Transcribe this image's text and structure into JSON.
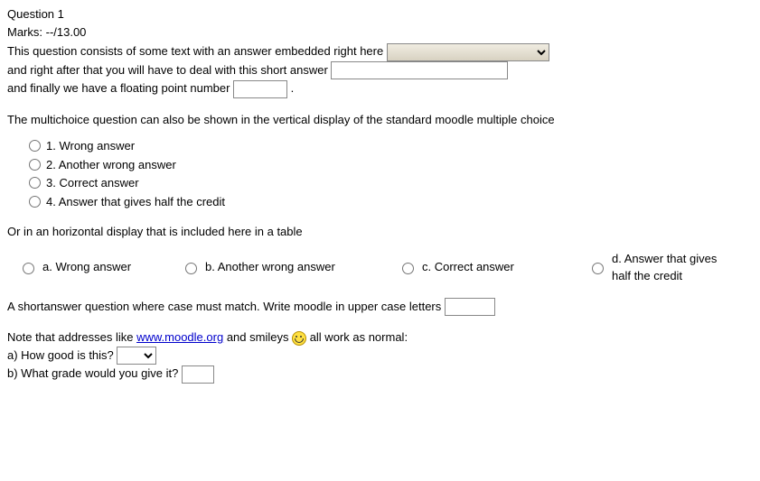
{
  "header": {
    "title": "Question 1",
    "marks": "Marks: --/13.00"
  },
  "intro": {
    "line1_before": "This question consists of some text with an answer embedded right here ",
    "line2_before": "and right after that you will have to deal with this short answer ",
    "line3_before": "and finally we have a floating point number ",
    "line3_after": " ."
  },
  "multichoice_intro": "The multichoice question can also be shown in the vertical display of the standard moodle multiple choice",
  "vertical_options": [
    {
      "label": "1. Wrong answer"
    },
    {
      "label": "2. Another wrong answer"
    },
    {
      "label": "3. Correct answer"
    },
    {
      "label": "4. Answer that gives half the credit"
    }
  ],
  "horizontal_intro": "Or in an horizontal display that is included here in a table",
  "horizontal_options": [
    {
      "label": "a. Wrong answer"
    },
    {
      "label": "b. Another wrong answer"
    },
    {
      "label": "c. Correct answer"
    },
    {
      "label": "d. Answer that gives half the credit"
    }
  ],
  "shortanswer_case": "A shortanswer question where case must match. Write moodle in upper case letters ",
  "note": {
    "before_link": "Note that addresses like ",
    "link_text": "www.moodle.org",
    "after_link": " and smileys ",
    "after_smiley": " all work as normal:"
  },
  "sub_a": "a) How good is this? ",
  "sub_b": "b) What grade would you give it? "
}
